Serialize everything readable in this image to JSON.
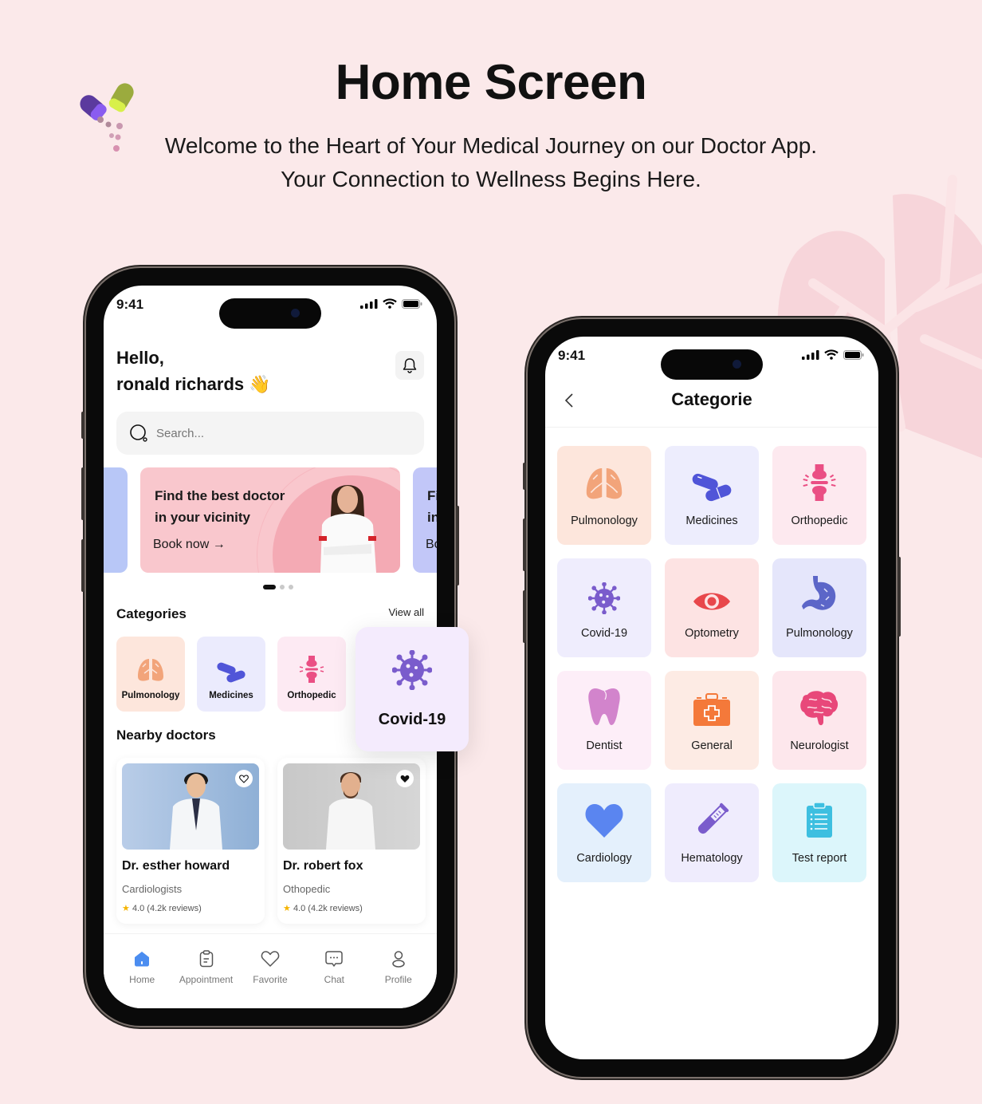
{
  "header": {
    "title": "Home Screen",
    "subtitle": "Welcome to the Heart of Your Medical Journey on our Doctor App. Your Connection to Wellness Begins Here."
  },
  "home": {
    "status_time": "9:41",
    "greeting_line1": "Hello,",
    "greeting_line2": "ronald richards 👋",
    "search_placeholder": "Search...",
    "banner": {
      "title_line1": "Find the best doctor",
      "title_line2": "in your vicinity",
      "cta": "Book now →",
      "peek_right_1": "Fi",
      "peek_right_2": "in",
      "peek_right_3": "Bo",
      "active_index": 0,
      "count": 3
    },
    "categories_title": "Categories",
    "view_all": "View all",
    "categories": [
      {
        "label": "Pulmonology",
        "icon": "lungs-icon",
        "bg": "#fde6dc",
        "color": "#f2a47a"
      },
      {
        "label": "Medicines",
        "icon": "pills-icon",
        "bg": "#ebebfd",
        "color": "#5055d8"
      },
      {
        "label": "Orthopedic",
        "icon": "joint-icon",
        "bg": "#fdeaf3",
        "color": "#ea4f84"
      }
    ],
    "highlight_category": {
      "label": "Covid-19",
      "icon": "virus-icon",
      "color": "#7a5ccc"
    },
    "nearby_title": "Nearby doctors",
    "doctors": [
      {
        "name": "Dr. esther howard",
        "specialty": "Cardiologists",
        "rating": "4.0",
        "reviews": "(4.2k reviews)",
        "favorite": false
      },
      {
        "name": "Dr. robert fox",
        "specialty": "Othopedic",
        "rating": "4.0",
        "reviews": "(4.2k reviews)",
        "favorite": true
      }
    ],
    "tabs": [
      {
        "label": "Home",
        "icon": "home-icon",
        "active": true
      },
      {
        "label": "Appointment",
        "icon": "clipboard-icon",
        "active": false
      },
      {
        "label": "Favorite",
        "icon": "heart-icon",
        "active": false
      },
      {
        "label": "Chat",
        "icon": "chat-icon",
        "active": false
      },
      {
        "label": "Profile",
        "icon": "profile-icon",
        "active": false
      }
    ],
    "accent": "#4b8df0"
  },
  "category_screen": {
    "status_time": "9:41",
    "title": "Categorie",
    "items": [
      {
        "label": "Pulmonology",
        "icon": "lungs-icon",
        "bg": "#fde6dc"
      },
      {
        "label": "Medicines",
        "icon": "pills-icon",
        "bg": "#ededfd"
      },
      {
        "label": "Orthopedic",
        "icon": "joint-icon",
        "bg": "#fde9ef"
      },
      {
        "label": "Covid-19",
        "icon": "virus-icon",
        "bg": "#efedfd"
      },
      {
        "label": "Optometry",
        "icon": "eye-icon",
        "bg": "#fde3e3"
      },
      {
        "label": "Pulmonology",
        "icon": "stomach-icon",
        "bg": "#e5e6fb"
      },
      {
        "label": "Dentist",
        "icon": "tooth-icon",
        "bg": "#fdeef8"
      },
      {
        "label": "General",
        "icon": "first-aid-kit-icon",
        "bg": "#fdebe4"
      },
      {
        "label": "Neurologist",
        "icon": "brain-icon",
        "bg": "#fde7ec"
      },
      {
        "label": "Cardiology",
        "icon": "heart-icon",
        "bg": "#e4f0fc"
      },
      {
        "label": "Hematology",
        "icon": "test-tube-icon",
        "bg": "#efecfd"
      },
      {
        "label": "Test report",
        "icon": "clipboard-list-icon",
        "bg": "#dcf6fb"
      }
    ]
  }
}
